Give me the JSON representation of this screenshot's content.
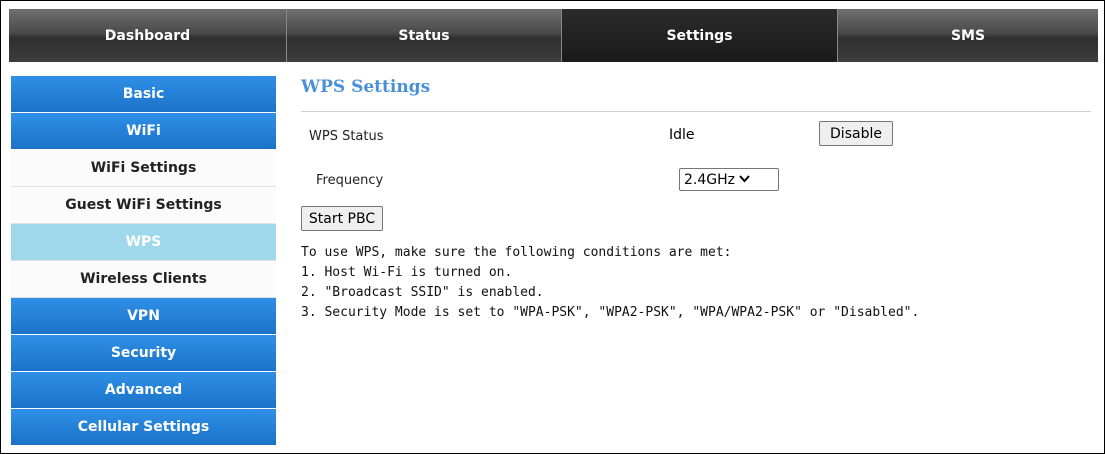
{
  "topnav": {
    "tabs": [
      {
        "label": "Dashboard"
      },
      {
        "label": "Status"
      },
      {
        "label": "Settings"
      },
      {
        "label": "SMS"
      }
    ]
  },
  "sidebar": {
    "items": [
      {
        "label": "Basic"
      },
      {
        "label": "WiFi"
      },
      {
        "label": "WiFi Settings"
      },
      {
        "label": "Guest WiFi Settings"
      },
      {
        "label": "WPS"
      },
      {
        "label": "Wireless Clients"
      },
      {
        "label": "VPN"
      },
      {
        "label": "Security"
      },
      {
        "label": "Advanced"
      },
      {
        "label": "Cellular Settings"
      }
    ]
  },
  "main": {
    "title": "WPS Settings",
    "wps_status_label": "WPS Status",
    "wps_status_value": "Idle",
    "disable_button": "Disable",
    "frequency_label": "Frequency",
    "frequency_value": "2.4GHz",
    "start_pbc_button": "Start PBC",
    "info_lines": [
      "To use WPS, make sure the following conditions are met:",
      "1. Host Wi-Fi is turned on.",
      "2. \"Broadcast SSID\" is enabled.",
      "3. Security Mode is set to \"WPA-PSK\", \"WPA2-PSK\", \"WPA/WPA2-PSK\" or \"Disabled\"."
    ]
  },
  "colors": {
    "accent_blue": "#1b73c9",
    "active_sub": "#9fd8ea",
    "title_blue": "#4a90d9"
  }
}
